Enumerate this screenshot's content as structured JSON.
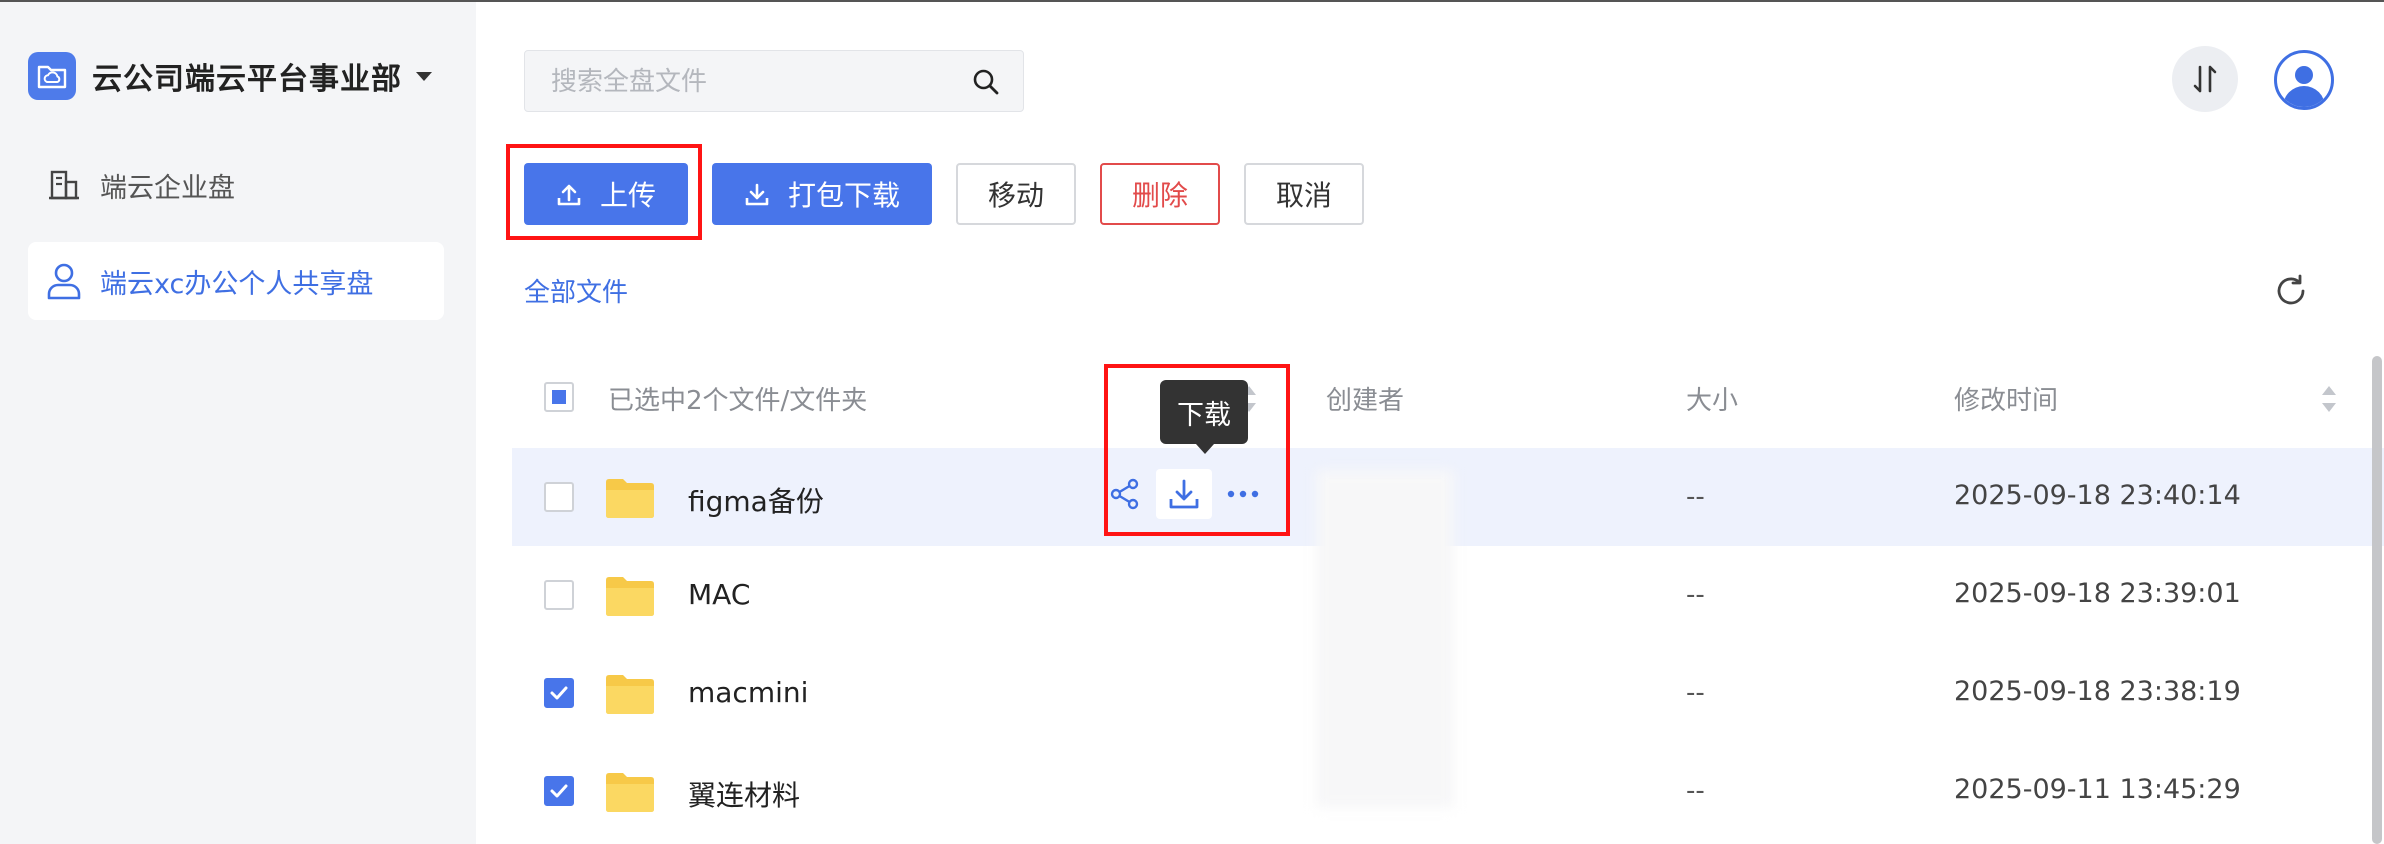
{
  "sidebar": {
    "brand": "云公司端云平台事业部",
    "items": [
      {
        "label": "端云企业盘",
        "icon": "building-icon",
        "active": false
      },
      {
        "label": "端云xc办公个人共享盘",
        "icon": "user-icon",
        "active": true
      }
    ]
  },
  "search": {
    "placeholder": "搜索全盘文件",
    "value": ""
  },
  "toolbar": {
    "upload": "上传",
    "pack_download": "打包下载",
    "move": "移动",
    "delete": "删除",
    "cancel": "取消"
  },
  "breadcrumb": "全部文件",
  "table": {
    "selected_text": "已选中2个文件/文件夹",
    "columns": {
      "creator": "创建者",
      "size": "大小",
      "modified": "修改时间"
    },
    "rows": [
      {
        "name": "figma备份",
        "size": "--",
        "modified": "2025-09-18 23:40:14",
        "checked": false
      },
      {
        "name": "MAC",
        "size": "--",
        "modified": "2025-09-18 23:39:01",
        "checked": false
      },
      {
        "name": "macmini",
        "size": "--",
        "modified": "2025-09-18 23:38:19",
        "checked": true
      },
      {
        "name": "翼连材料",
        "size": "--",
        "modified": "2025-09-11 13:45:29",
        "checked": true
      }
    ]
  },
  "tooltip": "下载",
  "colors": {
    "accent": "#4875ea",
    "danger": "#e24b4b",
    "highlight_box": "#ff1414",
    "folder": "#f7c948"
  }
}
